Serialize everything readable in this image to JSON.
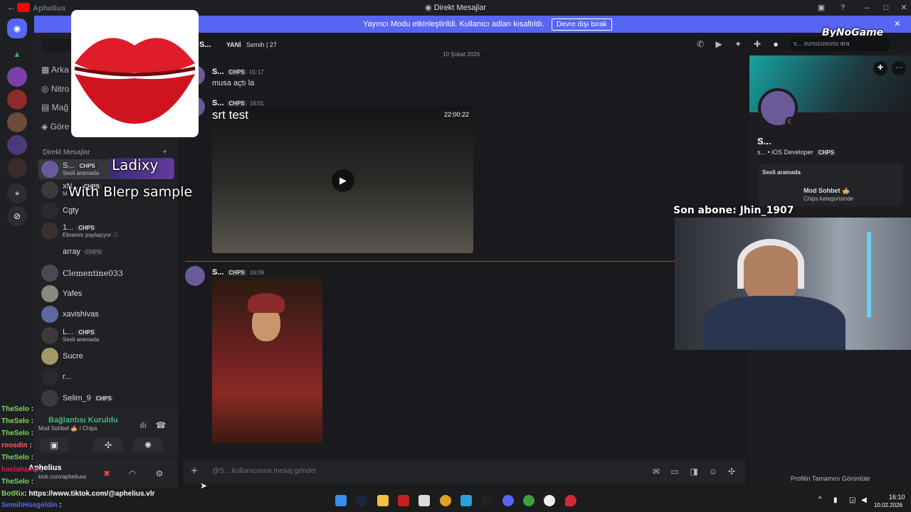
{
  "window": {
    "title": "Direkt Mesajlar",
    "app_name": "Aphelius"
  },
  "banner": {
    "message": "Yayıncı Modu etkinleştirildi. Kullanıcı adları kısaltıldı.",
    "button": "Devre dışı bırak"
  },
  "watermark": "ByNoGame",
  "sidebar": {
    "nav": [
      "Arka",
      "Nitro",
      "Mağ",
      "Göre"
    ],
    "dm_header": "Direkt Mesajlar",
    "dms": [
      {
        "name": "S...",
        "badge": "CHPS",
        "sub": "Sesli aramada"
      },
      {
        "name": "xN...",
        "badge": "CHPS",
        "sub": "M"
      },
      {
        "name": "Cgty",
        "badge": "",
        "sub": ""
      },
      {
        "name": "1...",
        "badge": "CHPS",
        "sub": "Ekranını paylaşıyor"
      },
      {
        "name": "array",
        "badge": "CHPS",
        "sub": ""
      },
      {
        "name": "Clementine033",
        "badge": "",
        "sub": ""
      },
      {
        "name": "Yafes",
        "badge": "",
        "sub": ""
      },
      {
        "name": "xavishivas",
        "badge": "",
        "sub": ""
      },
      {
        "name": "L...",
        "badge": "CHPS",
        "sub": "Sesli aramada"
      },
      {
        "name": "Sucre",
        "badge": "",
        "sub": ""
      },
      {
        "name": "r...",
        "badge": "",
        "sub": ""
      },
      {
        "name": "Selim_9",
        "badge": "CHPS",
        "sub": ""
      }
    ],
    "voice": {
      "status": "Bağlantısı Kuruldu",
      "channel": "Mod Sohbet 🥧 / Chips"
    },
    "user": {
      "name": "Aphelius",
      "sub": "kick.com/apheliuss"
    }
  },
  "chat_header": {
    "name": "S...",
    "tag": "YANİ",
    "detail": "Semih | 27",
    "search_placeholder": "s... sunucusunu ara"
  },
  "messages": [
    {
      "author": "S...",
      "badge": "CHPS",
      "time": "01:17",
      "text": "musa açtı la"
    },
    {
      "author": "S...",
      "badge": "CHPS",
      "time": "16:01",
      "text": "srt test",
      "video_time": "22:00:22"
    },
    {
      "author": "S...",
      "badge": "CHPS",
      "time": "16:09",
      "text": ""
    }
  ],
  "date_divider": "10 Şubat 2026",
  "composer": {
    "placeholder": "@S... kullanıcısına mesaj gönder"
  },
  "profile": {
    "name": "S...",
    "sub": "s... • iOS Developer",
    "badge": "CHPS",
    "voice_title": "Sesli aramada",
    "voice_channel": "Mod Sohbet 🥧",
    "voice_category": "Chips kategorisinde",
    "view_full": "Profilin Tamamını Görüntüle"
  },
  "overlay": {
    "ladixy": "Ladixy",
    "blerp": "With Blerp sample",
    "sub_alert": "Son abone: Jhin_1907"
  },
  "stream_chat": [
    {
      "user": "TheSelo",
      "text": ":",
      "color": "#7ed957"
    },
    {
      "user": "TheSelo",
      "text": ":",
      "color": "#7ed957"
    },
    {
      "user": "TheSelo",
      "text": ":",
      "color": "#7ed957"
    },
    {
      "user": "roosdin",
      "text": ":",
      "color": "#ff5c5c"
    },
    {
      "user": "TheSelo",
      "text": ":",
      "color": "#7ed957"
    },
    {
      "user": "haslahamn",
      "text": ":",
      "color": "#d21e4a"
    },
    {
      "user": "TheSelo",
      "text": ":",
      "color": "#7ed957"
    }
  ],
  "bot_line": {
    "user": "BotRix",
    "text": ": https://www.tiktok.com/@aphelius.vlr"
  },
  "bot_line2": {
    "user": "SemihHosgeldin",
    "text": ":"
  },
  "taskbar": {
    "time": "16:10",
    "date": "10.02.2026"
  },
  "colors": {
    "blurple": "#5865f2",
    "background": "#1a1a1e",
    "sidebar": "#202025",
    "chips_green": "#43b581"
  }
}
